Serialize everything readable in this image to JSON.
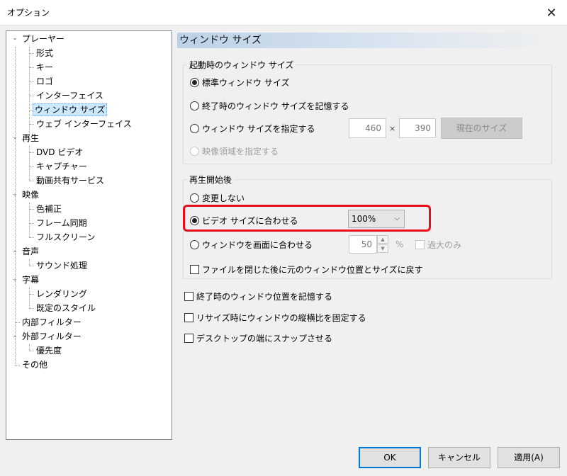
{
  "window": {
    "title": "オプション",
    "close_glyph": "✕"
  },
  "tree": {
    "items": [
      {
        "label": "プレーヤー",
        "toggle": "⌄"
      },
      {
        "label": "形式"
      },
      {
        "label": "キー"
      },
      {
        "label": "ロゴ"
      },
      {
        "label": "インターフェイス"
      },
      {
        "label": "ウィンドウ サイズ",
        "selected": true
      },
      {
        "label": "ウェブ インターフェイス"
      },
      {
        "label": "再生",
        "toggle": "⌄"
      },
      {
        "label": "DVD ビデオ"
      },
      {
        "label": "キャプチャー"
      },
      {
        "label": "動画共有サービス"
      },
      {
        "label": "映像",
        "toggle": "⌄"
      },
      {
        "label": "色補正"
      },
      {
        "label": "フレーム同期"
      },
      {
        "label": "フルスクリーン"
      },
      {
        "label": "音声",
        "toggle": "⌄"
      },
      {
        "label": "サウンド処理"
      },
      {
        "label": "字幕",
        "toggle": "⌄"
      },
      {
        "label": "レンダリング"
      },
      {
        "label": "既定のスタイル"
      },
      {
        "label": "内部フィルター"
      },
      {
        "label": "外部フィルター",
        "toggle": "⌄"
      },
      {
        "label": "優先度"
      },
      {
        "label": "その他"
      }
    ]
  },
  "panel": {
    "header": "ウィンドウ サイズ",
    "startup": {
      "group_label": "起動時のウィンドウ サイズ",
      "opt_standard": "標準ウィンドウ サイズ",
      "opt_remember": "終了時のウィンドウ サイズを記憶する",
      "opt_specify": "ウィンドウ サイズを指定する",
      "opt_video_area": "映像領域を指定する",
      "width_value": "460",
      "times": "×",
      "height_value": "390",
      "current_size_button": "現在のサイズ"
    },
    "after_play": {
      "group_label": "再生開始後",
      "opt_no_change": "変更しない",
      "opt_fit_video": "ビデオ サイズに合わせる",
      "zoom_value": "100%",
      "opt_fit_screen": "ウィンドウを画面に合わせる",
      "screen_percent_value": "50",
      "percent_sign": "%",
      "oversize_label": "過大のみ",
      "restore_label": "ファイルを閉じた後に元のウィンドウ位置とサイズに戻す"
    },
    "remember_position": "終了時のウィンドウ位置を記憶する",
    "fix_aspect": "リサイズ時にウィンドウの縦横比を固定する",
    "snap_desktop": "デスクトップの端にスナップさせる"
  },
  "buttons": {
    "ok": "OK",
    "cancel": "キャンセル",
    "apply": "適用(A)"
  },
  "colors": {
    "highlight": "#e8111b",
    "selection": "#cce8ff",
    "default_button": "#0078d7"
  }
}
